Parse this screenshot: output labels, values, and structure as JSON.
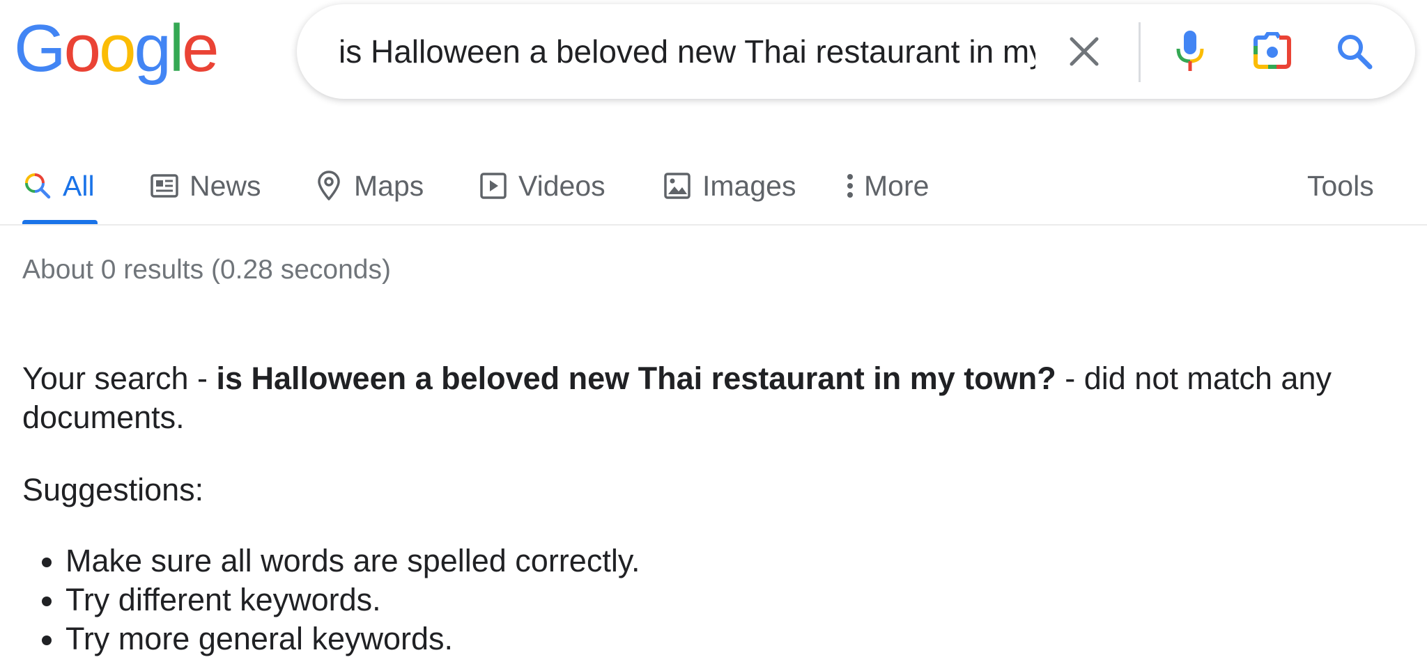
{
  "logo": {
    "letters": [
      "G",
      "o",
      "o",
      "g",
      "l",
      "e"
    ],
    "colors": [
      "#4285F4",
      "#EA4335",
      "#FBBC05",
      "#4285F4",
      "#34A853",
      "#EA4335"
    ]
  },
  "search": {
    "query": "is Halloween a beloved new Thai restaurant in my town?",
    "clear_icon": "close-icon",
    "mic_icon": "microphone-icon",
    "lens_icon": "camera-lens-icon",
    "search_icon": "search-icon"
  },
  "tabs": [
    {
      "label": "All",
      "icon": "search-multicolor-icon",
      "active": true
    },
    {
      "label": "News",
      "icon": "newspaper-icon",
      "active": false
    },
    {
      "label": "Maps",
      "icon": "map-pin-icon",
      "active": false
    },
    {
      "label": "Videos",
      "icon": "play-box-icon",
      "active": false
    },
    {
      "label": "Images",
      "icon": "image-icon",
      "active": false
    },
    {
      "label": "More",
      "icon": "vertical-dots-icon",
      "active": false
    }
  ],
  "tools_label": "Tools",
  "result_stats": "About 0 results (0.28 seconds)",
  "no_match": {
    "prefix": "Your search - ",
    "query": "is Halloween a beloved new Thai restaurant in my town?",
    "suffix": " - did not match any documents."
  },
  "suggestions": {
    "title": "Suggestions:",
    "items": [
      "Make sure all words are spelled correctly.",
      "Try different keywords.",
      "Try more general keywords."
    ]
  },
  "colors": {
    "accent_blue": "#1a73e8",
    "tab_gray": "#5f6368",
    "stats_gray": "#70757a",
    "text": "#202124"
  }
}
